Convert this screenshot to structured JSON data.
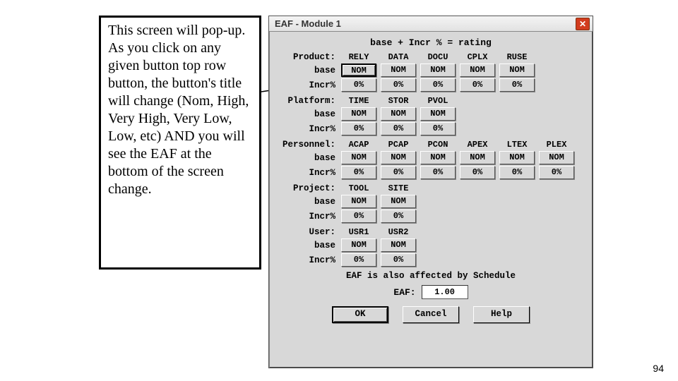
{
  "annotation": "This screen will pop-up. As you click on any given button top row button, the button's title will change (Nom, High, Very High, Very Low, Low, etc) AND you will see the EAF at the bottom of the screen change.",
  "dialog": {
    "title": "EAF - Module 1",
    "formula": "base + Incr % = rating",
    "labels": {
      "base": "base",
      "incr": "Incr%"
    },
    "sections": [
      {
        "name": "Product:",
        "cols": [
          "RELY",
          "DATA",
          "DOCU",
          "CPLX",
          "RUSE"
        ],
        "base": [
          "NOM",
          "NOM",
          "NOM",
          "NOM",
          "NOM"
        ],
        "incr": [
          "0%",
          "0%",
          "0%",
          "0%",
          "0%"
        ]
      },
      {
        "name": "Platform:",
        "cols": [
          "TIME",
          "STOR",
          "PVOL"
        ],
        "base": [
          "NOM",
          "NOM",
          "NOM"
        ],
        "incr": [
          "0%",
          "0%",
          "0%"
        ]
      },
      {
        "name": "Personnel:",
        "cols": [
          "ACAP",
          "PCAP",
          "PCON",
          "APEX",
          "LTEX",
          "PLEX"
        ],
        "base": [
          "NOM",
          "NOM",
          "NOM",
          "NOM",
          "NOM",
          "NOM"
        ],
        "incr": [
          "0%",
          "0%",
          "0%",
          "0%",
          "0%",
          "0%"
        ]
      },
      {
        "name": "Project:",
        "cols": [
          "TOOL",
          "SITE"
        ],
        "base": [
          "NOM",
          "NOM"
        ],
        "incr": [
          "0%",
          "0%"
        ]
      },
      {
        "name": "User:",
        "cols": [
          "USR1",
          "USR2"
        ],
        "base": [
          "NOM",
          "NOM"
        ],
        "incr": [
          "0%",
          "0%"
        ]
      }
    ],
    "eaf_note": "EAF is also affected by Schedule",
    "eaf_label": "EAF:",
    "eaf_value": "1.00",
    "actions": {
      "ok": "OK",
      "cancel": "Cancel",
      "help": "Help"
    }
  },
  "page_number": "94"
}
